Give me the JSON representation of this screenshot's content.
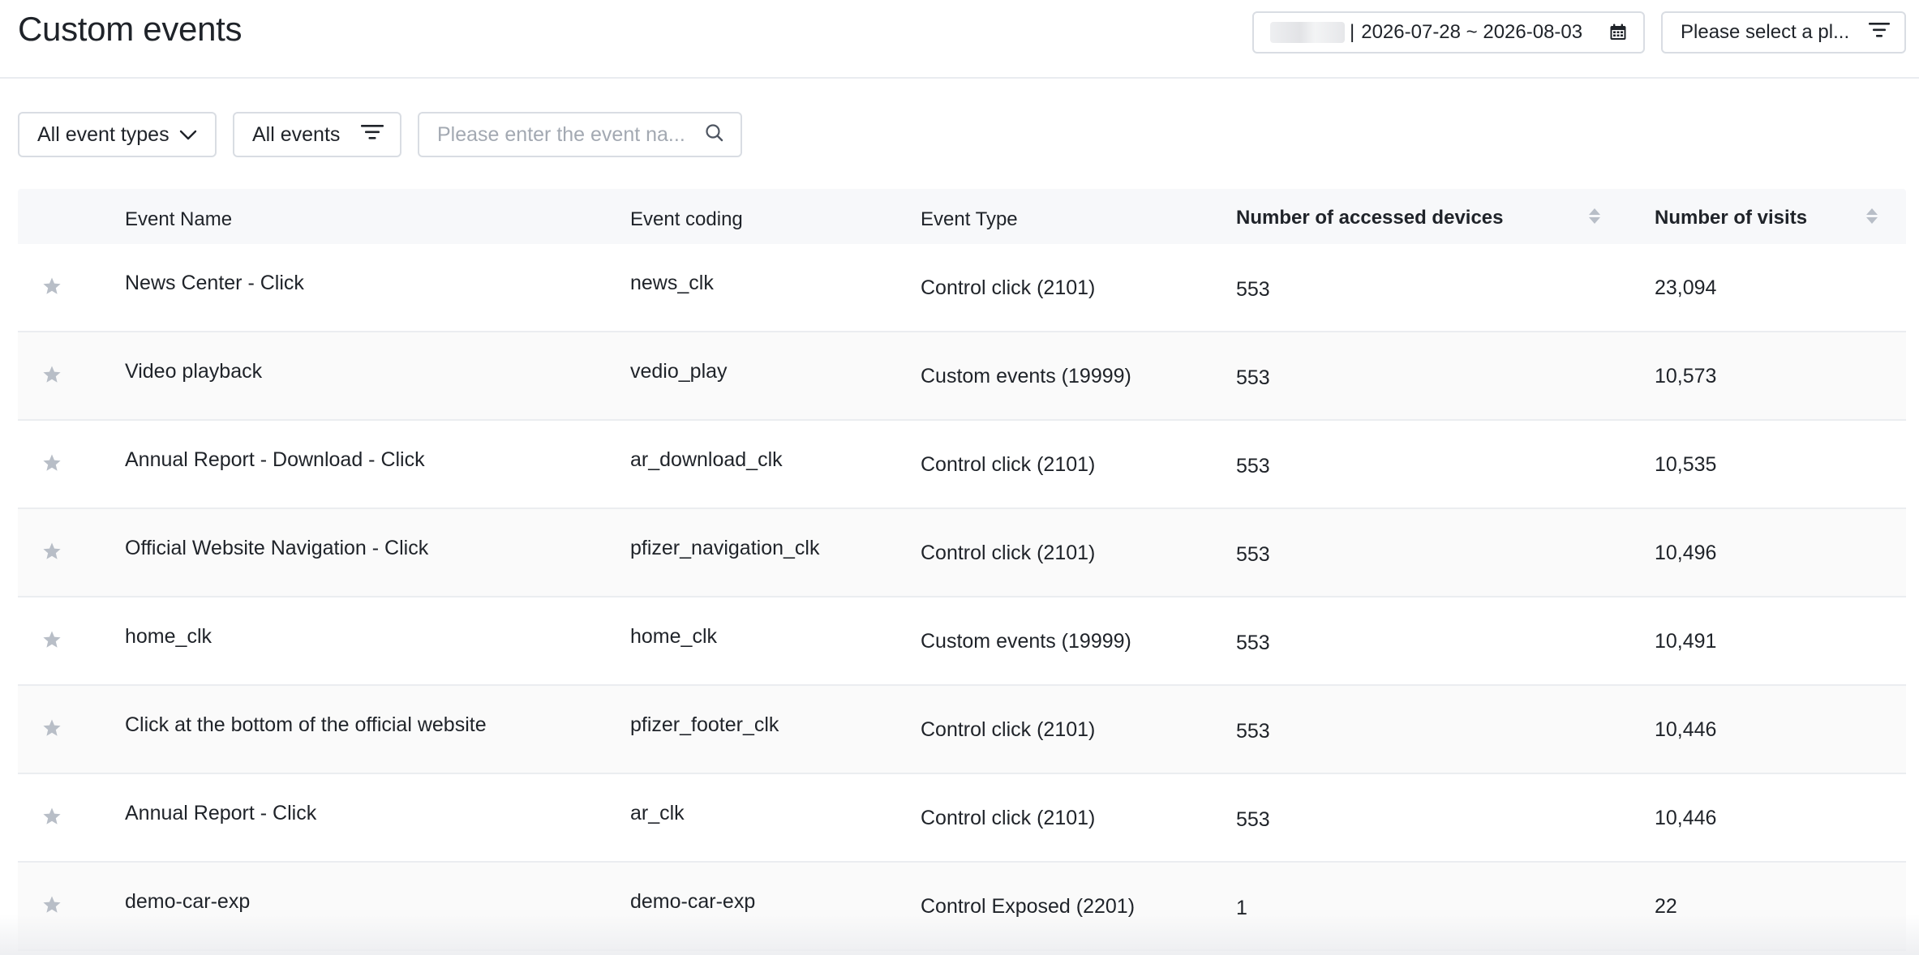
{
  "header": {
    "title": "Custom events",
    "date_separator": "|",
    "date_range": "2026-07-28 ~ 2026-08-03",
    "platform_placeholder": "Please select a pl..."
  },
  "filters": {
    "event_types_label": "All event types",
    "events_label": "All events",
    "search_placeholder": "Please enter the event na..."
  },
  "table": {
    "columns": {
      "name": "Event Name",
      "code": "Event coding",
      "type": "Event Type",
      "devices": "Number of accessed devices",
      "visits": "Number of visits"
    },
    "rows": [
      {
        "name": "News Center - Click",
        "code": "news_clk",
        "type": "Control click (2101)",
        "devices": "553",
        "visits": "23,094"
      },
      {
        "name": "Video playback",
        "code": "vedio_play",
        "type": "Custom events (19999)",
        "devices": "553",
        "visits": "10,573"
      },
      {
        "name": "Annual Report - Download - Click",
        "code": "ar_download_clk",
        "type": "Control click (2101)",
        "devices": "553",
        "visits": "10,535"
      },
      {
        "name": "Official Website Navigation - Click",
        "code": "pfizer_navigation_clk",
        "type": "Control click (2101)",
        "devices": "553",
        "visits": "10,496"
      },
      {
        "name": "home_clk",
        "code": "home_clk",
        "type": "Custom events (19999)",
        "devices": "553",
        "visits": "10,491"
      },
      {
        "name": "Click at the bottom of the official website",
        "code": "pfizer_footer_clk",
        "type": "Control click (2101)",
        "devices": "553",
        "visits": "10,446"
      },
      {
        "name": "Annual Report - Click",
        "code": "ar_clk",
        "type": "Control click (2101)",
        "devices": "553",
        "visits": "10,446"
      },
      {
        "name": "demo-car-exp",
        "code": "demo-car-exp",
        "type": "Control Exposed (2201)",
        "devices": "1",
        "visits": "22"
      }
    ]
  },
  "icons": {
    "calendar": "calendar-icon",
    "filter": "filter-icon",
    "chevron": "chevron-down-icon",
    "search": "search-icon",
    "star": "star-icon",
    "sort": "sort-icon"
  },
  "colors": {
    "text": "#1f2329",
    "border": "#d9dde3",
    "header_bg": "#f7f8fa",
    "star": "#b8bec7",
    "placeholder": "#a3a9b2"
  }
}
